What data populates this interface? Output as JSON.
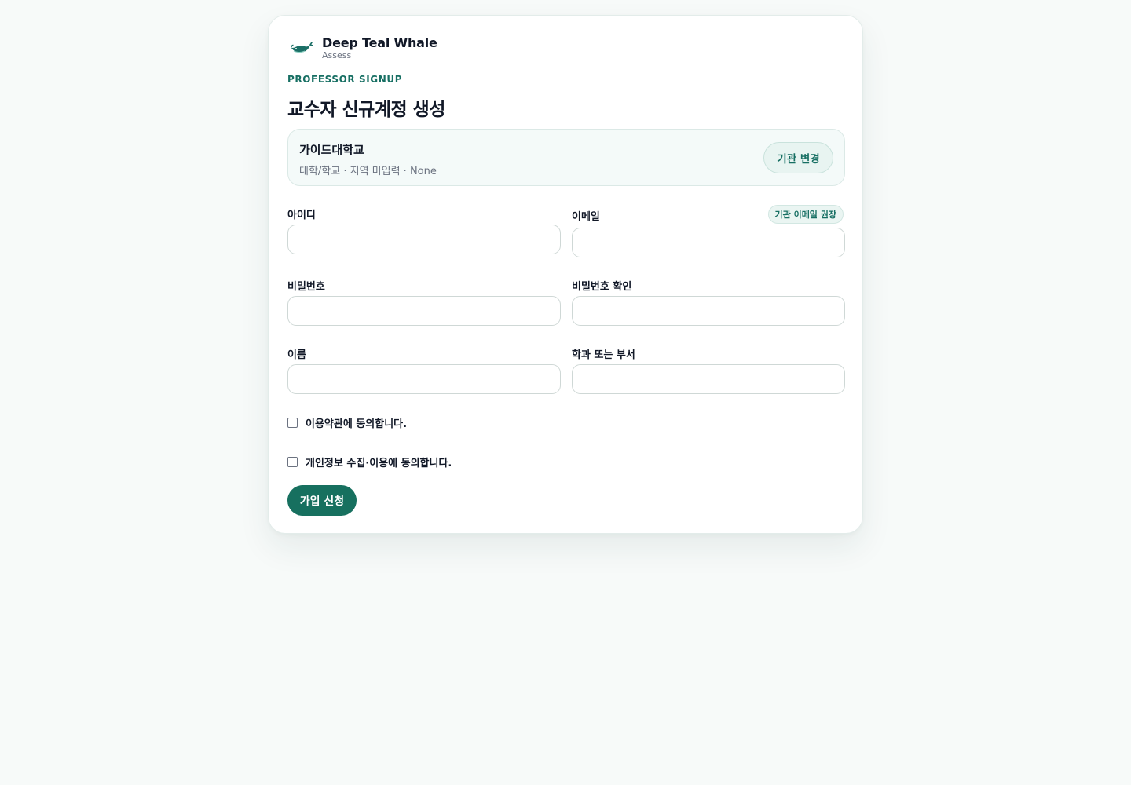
{
  "brand": {
    "name": "Deep Teal Whale",
    "sub": "Assess",
    "logo_icon": "whale-icon"
  },
  "header": {
    "eyebrow": "PROFESSOR SIGNUP",
    "title": "교수자 신규계정 생성"
  },
  "institution": {
    "name": "가이드대학교",
    "meta": "대학/학교 · 지역 미입력 · None",
    "change_label": "기관 변경"
  },
  "form": {
    "id_label": "아이디",
    "id_value": "",
    "email_label": "이메일",
    "email_hint": "기관 이메일 권장",
    "email_value": "",
    "password_label": "비밀번호",
    "password_value": "",
    "password_confirm_label": "비밀번호 확인",
    "password_confirm_value": "",
    "name_label": "이름",
    "name_value": "",
    "dept_label": "학과 또는 부서",
    "dept_value": "",
    "terms_label": "이용약관에 동의합니다.",
    "terms_checked": false,
    "privacy_label": "개인정보 수집·이용에 동의합니다.",
    "privacy_checked": false,
    "submit_label": "가입 신청"
  },
  "colors": {
    "accent": "#17705f",
    "background": "#f7faf9"
  }
}
